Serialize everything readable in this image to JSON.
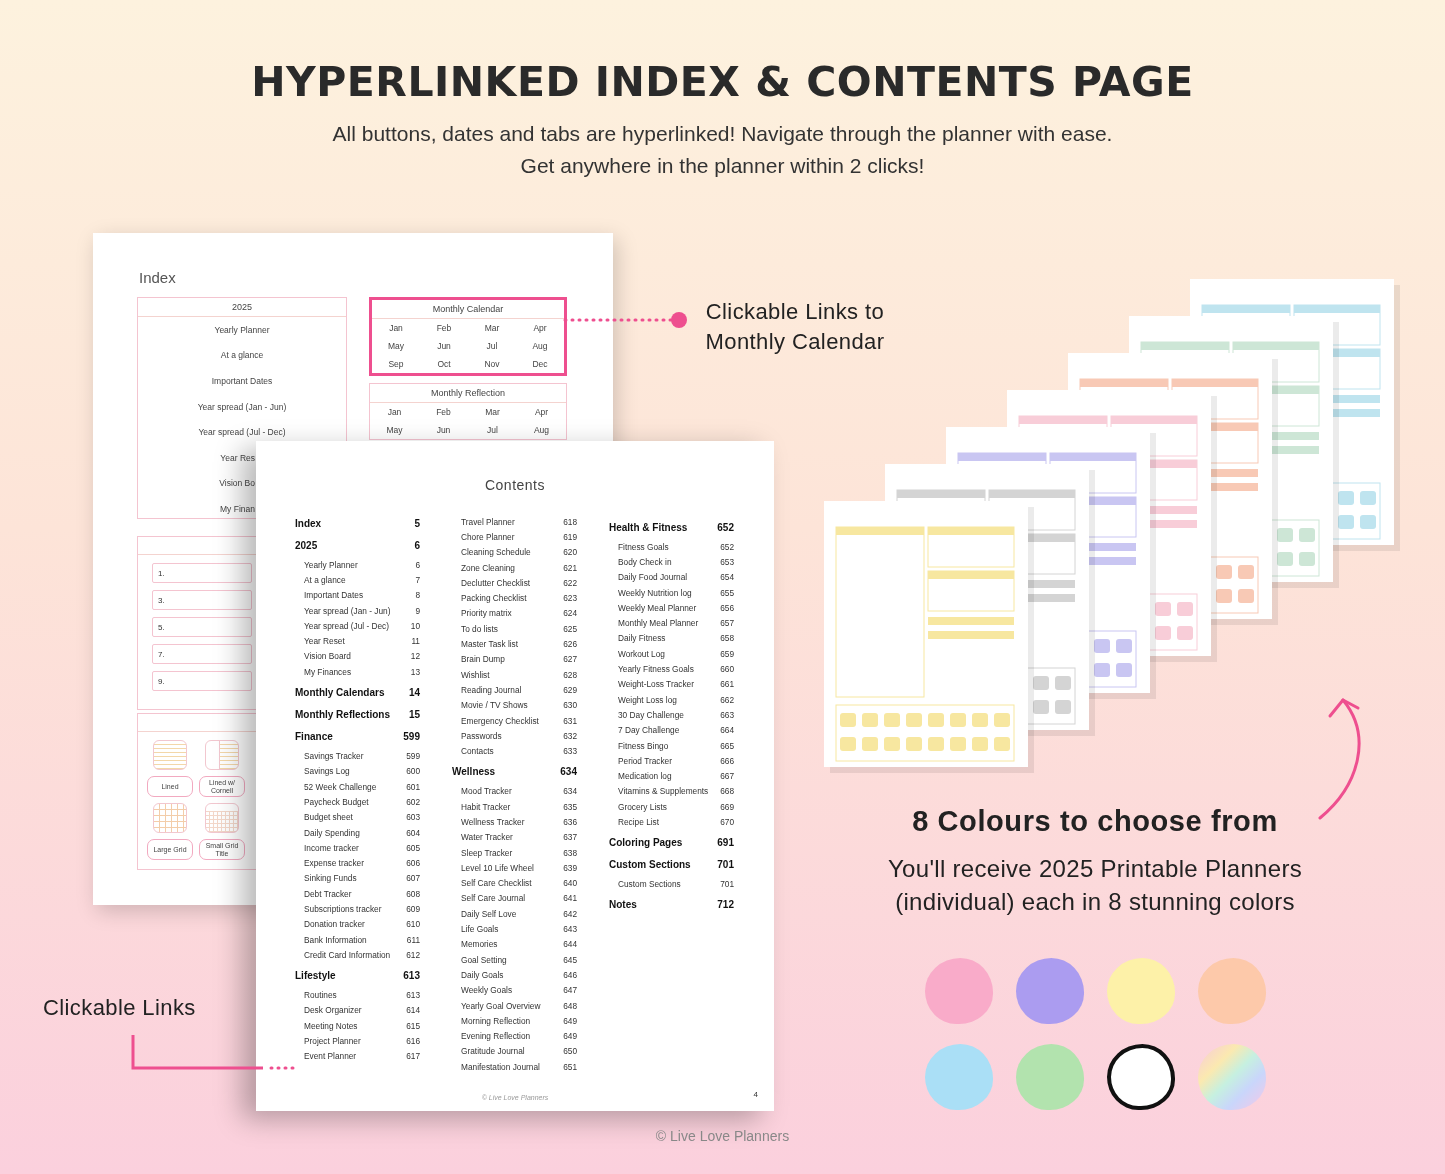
{
  "heading": {
    "title": "HYPERLINKED INDEX & CONTENTS PAGE",
    "subtitle": [
      "All buttons, dates and tabs are hyperlinked! Navigate through the planner with ease.",
      "Get anywhere in the planner within 2 clicks!"
    ]
  },
  "index_page": {
    "title": "Index",
    "year_box": {
      "heading": "2025",
      "items": [
        {
          "label": "Yearly Planner",
          "kind": "full"
        },
        {
          "label": "At a glance",
          "kind": "full"
        },
        {
          "label": "Important Dates",
          "kind": "full"
        },
        {
          "label": "Year spread (Jan - Jun)",
          "kind": "full"
        },
        {
          "label": "Year spread (Jul - Dec)",
          "kind": "full"
        },
        {
          "label": "Year Res",
          "kind": "cut"
        },
        {
          "label": "Vision Bo",
          "kind": "cut"
        },
        {
          "label": "My Finan",
          "kind": "cut"
        }
      ]
    },
    "month_boxes": [
      {
        "heading": "Monthly Calendar",
        "highlighted": true,
        "months": [
          "Jan",
          "Feb",
          "Mar",
          "Apr",
          "May",
          "Jun",
          "Jul",
          "Aug",
          "Sep",
          "Oct",
          "Nov",
          "Dec"
        ]
      },
      {
        "heading": "Monthly Reflection",
        "highlighted": false,
        "months": [
          "Jan",
          "Feb",
          "Mar",
          "Apr",
          "May",
          "Jun",
          "Jul",
          "Aug"
        ]
      }
    ],
    "custom_fields": [
      "1.",
      "3.",
      "5.",
      "7.",
      "9."
    ],
    "note_templates": [
      {
        "label": "Lined",
        "kind": "lined"
      },
      {
        "label": "Lined w/ Cornell",
        "kind": "cornell"
      },
      {
        "label": "Large Grid",
        "kind": "large-grid"
      },
      {
        "label": "Small Grid Title",
        "kind": "small-grid"
      }
    ]
  },
  "contents_page": {
    "title": "Contents",
    "columns": [
      [
        {
          "kind": "section",
          "label": "Index",
          "page": "5"
        },
        {
          "kind": "section",
          "label": "2025",
          "page": "6"
        },
        {
          "kind": "item",
          "label": "Yearly Planner",
          "page": "6"
        },
        {
          "kind": "item",
          "label": "At a glance",
          "page": "7"
        },
        {
          "kind": "item",
          "label": "Important Dates",
          "page": "8"
        },
        {
          "kind": "item",
          "label": "Year spread (Jan - Jun)",
          "page": "9"
        },
        {
          "kind": "item",
          "label": "Year spread (Jul - Dec)",
          "page": "10"
        },
        {
          "kind": "item",
          "label": "Year Reset",
          "page": "11"
        },
        {
          "kind": "item",
          "label": "Vision Board",
          "page": "12"
        },
        {
          "kind": "item",
          "label": "My Finances",
          "page": "13"
        },
        {
          "kind": "section",
          "label": "Monthly Calendars",
          "page": "14"
        },
        {
          "kind": "section",
          "label": "Monthly Reflections",
          "page": "15"
        },
        {
          "kind": "section",
          "label": "Finance",
          "page": "599"
        },
        {
          "kind": "item",
          "label": "Savings Tracker",
          "page": "599"
        },
        {
          "kind": "item",
          "label": "Savings Log",
          "page": "600"
        },
        {
          "kind": "item",
          "label": "52 Week Challenge",
          "page": "601"
        },
        {
          "kind": "item",
          "label": "Paycheck Budget",
          "page": "602"
        },
        {
          "kind": "item",
          "label": "Budget sheet",
          "page": "603"
        },
        {
          "kind": "item",
          "label": "Daily Spending",
          "page": "604"
        },
        {
          "kind": "item",
          "label": "Income tracker",
          "page": "605"
        },
        {
          "kind": "item",
          "label": "Expense tracker",
          "page": "606"
        },
        {
          "kind": "item",
          "label": "Sinking Funds",
          "page": "607"
        },
        {
          "kind": "item",
          "label": "Debt Tracker",
          "page": "608"
        },
        {
          "kind": "item",
          "label": "Subscriptions tracker",
          "page": "609"
        },
        {
          "kind": "item",
          "label": "Donation tracker",
          "page": "610"
        },
        {
          "kind": "item",
          "label": "Bank Information",
          "page": "611"
        },
        {
          "kind": "item",
          "label": "Credit Card Information",
          "page": "612"
        },
        {
          "kind": "section",
          "label": "Lifestyle",
          "page": "613"
        },
        {
          "kind": "item",
          "label": "Routines",
          "page": "613"
        },
        {
          "kind": "item",
          "label": "Desk Organizer",
          "page": "614"
        },
        {
          "kind": "item",
          "label": "Meeting Notes",
          "page": "615"
        },
        {
          "kind": "item",
          "label": "Project  Planner",
          "page": "616"
        },
        {
          "kind": "item",
          "label": "Event Planner",
          "page": "617"
        }
      ],
      [
        {
          "kind": "item",
          "label": "Travel Planner",
          "page": "618"
        },
        {
          "kind": "item",
          "label": "Chore Planner",
          "page": "619"
        },
        {
          "kind": "item",
          "label": "Cleaning Schedule",
          "page": "620"
        },
        {
          "kind": "item",
          "label": "Zone Cleaning",
          "page": "621"
        },
        {
          "kind": "item",
          "label": "Declutter Checklist",
          "page": "622"
        },
        {
          "kind": "item",
          "label": "Packing Checklist",
          "page": "623"
        },
        {
          "kind": "item",
          "label": "Priority matrix",
          "page": "624"
        },
        {
          "kind": "item",
          "label": "To do lists",
          "page": "625"
        },
        {
          "kind": "item",
          "label": "Master Task list",
          "page": "626"
        },
        {
          "kind": "item",
          "label": "Brain Dump",
          "page": "627"
        },
        {
          "kind": "item",
          "label": "Wishlist",
          "page": "628"
        },
        {
          "kind": "item",
          "label": "Reading Journal",
          "page": "629"
        },
        {
          "kind": "item",
          "label": "Movie / TV Shows",
          "page": "630"
        },
        {
          "kind": "item",
          "label": "Emergency Checklist",
          "page": "631"
        },
        {
          "kind": "item",
          "label": "Passwords",
          "page": "632"
        },
        {
          "kind": "item",
          "label": "Contacts",
          "page": "633"
        },
        {
          "kind": "section",
          "label": "Wellness",
          "page": "634"
        },
        {
          "kind": "item",
          "label": "Mood Tracker",
          "page": "634"
        },
        {
          "kind": "item",
          "label": "Habit Tracker",
          "page": "635"
        },
        {
          "kind": "item",
          "label": "Wellness Tracker",
          "page": "636"
        },
        {
          "kind": "item",
          "label": "Water Tracker",
          "page": "637"
        },
        {
          "kind": "item",
          "label": "Sleep Tracker",
          "page": "638"
        },
        {
          "kind": "item",
          "label": "Level 10 Life Wheel",
          "page": "639"
        },
        {
          "kind": "item",
          "label": "Self Care Checklist",
          "page": "640"
        },
        {
          "kind": "item",
          "label": "Self Care Journal",
          "page": "641"
        },
        {
          "kind": "item",
          "label": "Daily Self Love",
          "page": "642"
        },
        {
          "kind": "item",
          "label": "Life Goals",
          "page": "643"
        },
        {
          "kind": "item",
          "label": "Memories",
          "page": "644"
        },
        {
          "kind": "item",
          "label": "Goal Setting",
          "page": "645"
        },
        {
          "kind": "item",
          "label": "Daily Goals",
          "page": "646"
        },
        {
          "kind": "item",
          "label": "Weekly Goals",
          "page": "647"
        },
        {
          "kind": "item",
          "label": "Yearly Goal Overview",
          "page": "648"
        },
        {
          "kind": "item",
          "label": "Morning Reflection",
          "page": "649"
        },
        {
          "kind": "item",
          "label": "Evening Reflection",
          "page": "649"
        },
        {
          "kind": "item",
          "label": "Gratitude Journal",
          "page": "650"
        },
        {
          "kind": "item",
          "label": "Manifestation Journal",
          "page": "651"
        }
      ],
      [
        {
          "kind": "section",
          "label": "Health & Fitness",
          "page": "652"
        },
        {
          "kind": "item",
          "label": "Fitness Goals",
          "page": "652"
        },
        {
          "kind": "item",
          "label": "Body Check in",
          "page": "653"
        },
        {
          "kind": "item",
          "label": "Daily Food Journal",
          "page": "654"
        },
        {
          "kind": "item",
          "label": "Weekly Nutrition log",
          "page": "655"
        },
        {
          "kind": "item",
          "label": "Weekly Meal Planner",
          "page": "656"
        },
        {
          "kind": "item",
          "label": "Monthly Meal Planner",
          "page": "657"
        },
        {
          "kind": "item",
          "label": "Daily Fitness",
          "page": "658"
        },
        {
          "kind": "item",
          "label": "Workout Log",
          "page": "659"
        },
        {
          "kind": "item",
          "label": "Yearly Fitness Goals",
          "page": "660"
        },
        {
          "kind": "item",
          "label": "Weight-Loss Tracker",
          "page": "661"
        },
        {
          "kind": "item",
          "label": "Weight Loss log",
          "page": "662"
        },
        {
          "kind": "item",
          "label": "30 Day Challenge",
          "page": "663"
        },
        {
          "kind": "item",
          "label": "7 Day Challenge",
          "page": "664"
        },
        {
          "kind": "item",
          "label": "Fitness Bingo",
          "page": "665"
        },
        {
          "kind": "item",
          "label": "Period Tracker",
          "page": "666"
        },
        {
          "kind": "item",
          "label": "Medication log",
          "page": "667"
        },
        {
          "kind": "item",
          "label": "Vitamins & Supplements",
          "page": "668"
        },
        {
          "kind": "item",
          "label": "Grocery Lists",
          "page": "669"
        },
        {
          "kind": "item",
          "label": "Recipe List",
          "page": "670"
        },
        {
          "kind": "section",
          "label": "Coloring Pages",
          "page": "691"
        },
        {
          "kind": "section",
          "label": "Custom Sections",
          "page": "701"
        },
        {
          "kind": "item",
          "label": "Custom Sections",
          "page": "701"
        },
        {
          "kind": "section",
          "label": "Notes",
          "page": "712"
        }
      ]
    ],
    "footer": "© Live Love Planners",
    "page_number": "4"
  },
  "callouts": [
    {
      "text": "Clickable Links to Monthly Calendar"
    },
    {
      "text": "Clickable Links"
    }
  ],
  "colours": {
    "title": "8 Colours to choose from",
    "text": "You'll receive 2025 Printable Planners (individual) each in 8 stunning colors",
    "swatches": [
      {
        "kind": "solid",
        "color": "#f9abc9"
      },
      {
        "kind": "solid",
        "color": "#ab9cf0"
      },
      {
        "kind": "solid",
        "color": "#fdf1a8"
      },
      {
        "kind": "solid",
        "color": "#fdc9aa"
      },
      {
        "kind": "solid",
        "color": "#aadff6"
      },
      {
        "kind": "solid",
        "color": "#b2e3ae"
      },
      {
        "kind": "outline",
        "color": "#ffffff"
      },
      {
        "kind": "rainbow"
      }
    ]
  },
  "credit": "© Live Love Planners"
}
